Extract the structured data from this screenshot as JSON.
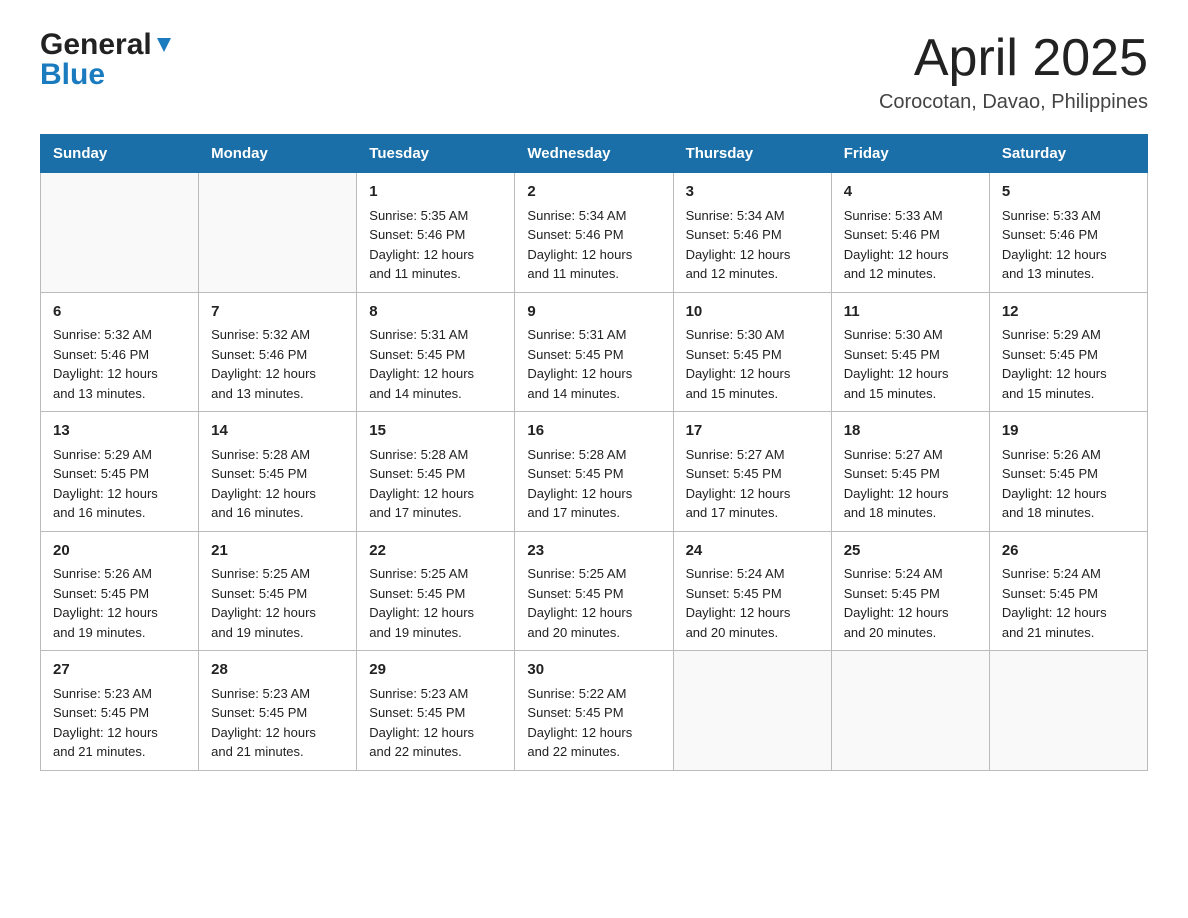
{
  "header": {
    "logo_general": "General",
    "logo_blue": "Blue",
    "month_title": "April 2025",
    "location": "Corocotan, Davao, Philippines"
  },
  "days_of_week": [
    "Sunday",
    "Monday",
    "Tuesday",
    "Wednesday",
    "Thursday",
    "Friday",
    "Saturday"
  ],
  "weeks": [
    [
      {
        "day": "",
        "info": ""
      },
      {
        "day": "",
        "info": ""
      },
      {
        "day": "1",
        "info": "Sunrise: 5:35 AM\nSunset: 5:46 PM\nDaylight: 12 hours\nand 11 minutes."
      },
      {
        "day": "2",
        "info": "Sunrise: 5:34 AM\nSunset: 5:46 PM\nDaylight: 12 hours\nand 11 minutes."
      },
      {
        "day": "3",
        "info": "Sunrise: 5:34 AM\nSunset: 5:46 PM\nDaylight: 12 hours\nand 12 minutes."
      },
      {
        "day": "4",
        "info": "Sunrise: 5:33 AM\nSunset: 5:46 PM\nDaylight: 12 hours\nand 12 minutes."
      },
      {
        "day": "5",
        "info": "Sunrise: 5:33 AM\nSunset: 5:46 PM\nDaylight: 12 hours\nand 13 minutes."
      }
    ],
    [
      {
        "day": "6",
        "info": "Sunrise: 5:32 AM\nSunset: 5:46 PM\nDaylight: 12 hours\nand 13 minutes."
      },
      {
        "day": "7",
        "info": "Sunrise: 5:32 AM\nSunset: 5:46 PM\nDaylight: 12 hours\nand 13 minutes."
      },
      {
        "day": "8",
        "info": "Sunrise: 5:31 AM\nSunset: 5:45 PM\nDaylight: 12 hours\nand 14 minutes."
      },
      {
        "day": "9",
        "info": "Sunrise: 5:31 AM\nSunset: 5:45 PM\nDaylight: 12 hours\nand 14 minutes."
      },
      {
        "day": "10",
        "info": "Sunrise: 5:30 AM\nSunset: 5:45 PM\nDaylight: 12 hours\nand 15 minutes."
      },
      {
        "day": "11",
        "info": "Sunrise: 5:30 AM\nSunset: 5:45 PM\nDaylight: 12 hours\nand 15 minutes."
      },
      {
        "day": "12",
        "info": "Sunrise: 5:29 AM\nSunset: 5:45 PM\nDaylight: 12 hours\nand 15 minutes."
      }
    ],
    [
      {
        "day": "13",
        "info": "Sunrise: 5:29 AM\nSunset: 5:45 PM\nDaylight: 12 hours\nand 16 minutes."
      },
      {
        "day": "14",
        "info": "Sunrise: 5:28 AM\nSunset: 5:45 PM\nDaylight: 12 hours\nand 16 minutes."
      },
      {
        "day": "15",
        "info": "Sunrise: 5:28 AM\nSunset: 5:45 PM\nDaylight: 12 hours\nand 17 minutes."
      },
      {
        "day": "16",
        "info": "Sunrise: 5:28 AM\nSunset: 5:45 PM\nDaylight: 12 hours\nand 17 minutes."
      },
      {
        "day": "17",
        "info": "Sunrise: 5:27 AM\nSunset: 5:45 PM\nDaylight: 12 hours\nand 17 minutes."
      },
      {
        "day": "18",
        "info": "Sunrise: 5:27 AM\nSunset: 5:45 PM\nDaylight: 12 hours\nand 18 minutes."
      },
      {
        "day": "19",
        "info": "Sunrise: 5:26 AM\nSunset: 5:45 PM\nDaylight: 12 hours\nand 18 minutes."
      }
    ],
    [
      {
        "day": "20",
        "info": "Sunrise: 5:26 AM\nSunset: 5:45 PM\nDaylight: 12 hours\nand 19 minutes."
      },
      {
        "day": "21",
        "info": "Sunrise: 5:25 AM\nSunset: 5:45 PM\nDaylight: 12 hours\nand 19 minutes."
      },
      {
        "day": "22",
        "info": "Sunrise: 5:25 AM\nSunset: 5:45 PM\nDaylight: 12 hours\nand 19 minutes."
      },
      {
        "day": "23",
        "info": "Sunrise: 5:25 AM\nSunset: 5:45 PM\nDaylight: 12 hours\nand 20 minutes."
      },
      {
        "day": "24",
        "info": "Sunrise: 5:24 AM\nSunset: 5:45 PM\nDaylight: 12 hours\nand 20 minutes."
      },
      {
        "day": "25",
        "info": "Sunrise: 5:24 AM\nSunset: 5:45 PM\nDaylight: 12 hours\nand 20 minutes."
      },
      {
        "day": "26",
        "info": "Sunrise: 5:24 AM\nSunset: 5:45 PM\nDaylight: 12 hours\nand 21 minutes."
      }
    ],
    [
      {
        "day": "27",
        "info": "Sunrise: 5:23 AM\nSunset: 5:45 PM\nDaylight: 12 hours\nand 21 minutes."
      },
      {
        "day": "28",
        "info": "Sunrise: 5:23 AM\nSunset: 5:45 PM\nDaylight: 12 hours\nand 21 minutes."
      },
      {
        "day": "29",
        "info": "Sunrise: 5:23 AM\nSunset: 5:45 PM\nDaylight: 12 hours\nand 22 minutes."
      },
      {
        "day": "30",
        "info": "Sunrise: 5:22 AM\nSunset: 5:45 PM\nDaylight: 12 hours\nand 22 minutes."
      },
      {
        "day": "",
        "info": ""
      },
      {
        "day": "",
        "info": ""
      },
      {
        "day": "",
        "info": ""
      }
    ]
  ]
}
